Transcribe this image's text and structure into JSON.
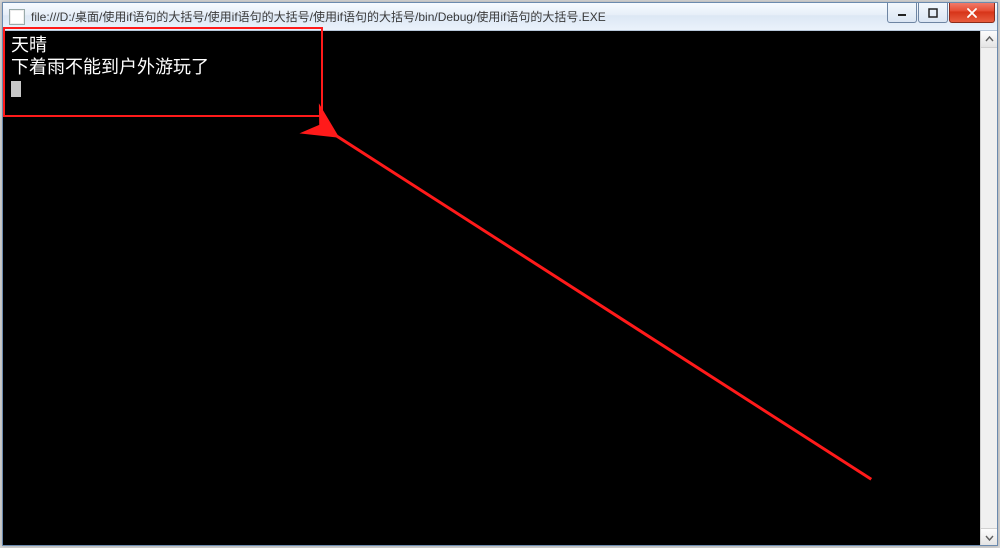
{
  "window": {
    "title": "file:///D:/桌面/使用if语句的大括号/使用if语句的大括号/使用if语句的大括号/bin/Debug/使用if语句的大括号.EXE"
  },
  "console": {
    "line1": "天晴",
    "line2": "下着雨不能到户外游玩了"
  },
  "controls": {
    "minimize": "minimize",
    "maximize": "maximize",
    "close": "close"
  },
  "colors": {
    "annotation": "#ff1a1a",
    "console_bg": "#000000",
    "console_fg": "#ffffff"
  }
}
